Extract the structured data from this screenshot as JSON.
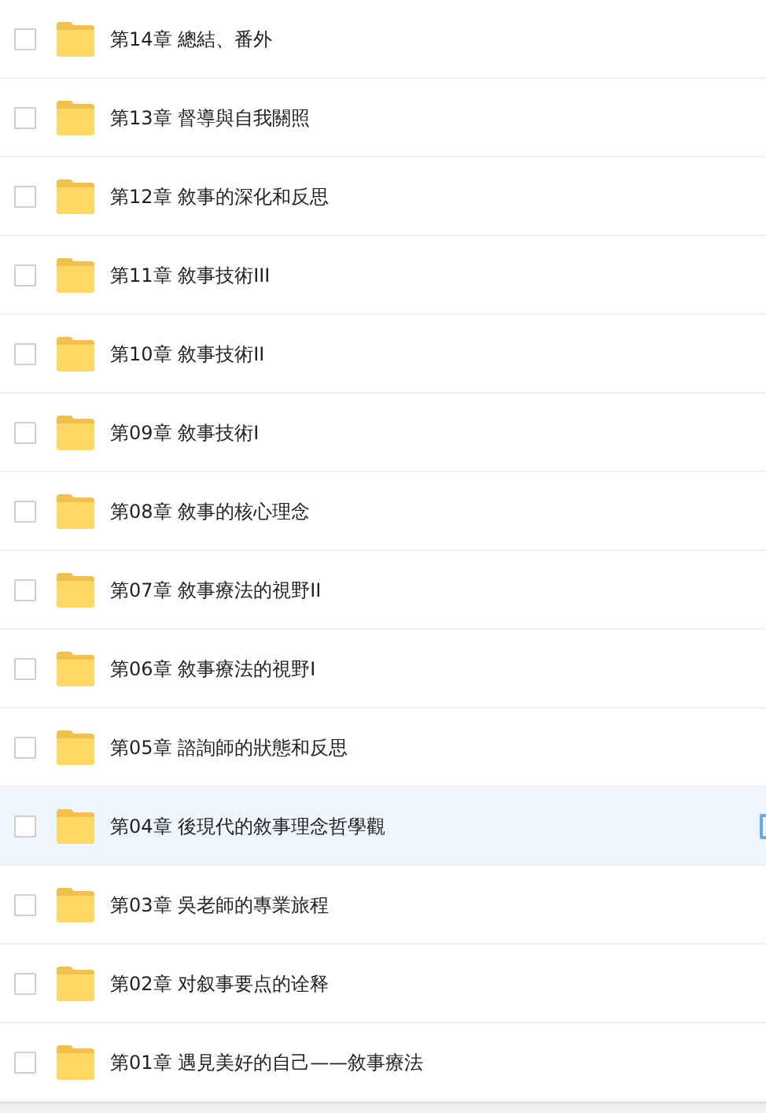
{
  "files": [
    {
      "name": "第14章 總結、番外",
      "checked": false,
      "highlighted": false
    },
    {
      "name": "第13章 督導與自我關照",
      "checked": false,
      "highlighted": false
    },
    {
      "name": "第12章 敘事的深化和反思",
      "checked": false,
      "highlighted": false
    },
    {
      "name": "第11章 敘事技術III",
      "checked": false,
      "highlighted": false
    },
    {
      "name": "第10章 敘事技術II",
      "checked": false,
      "highlighted": false
    },
    {
      "name": "第09章 敘事技術I",
      "checked": false,
      "highlighted": false
    },
    {
      "name": "第08章 敘事的核心理念",
      "checked": false,
      "highlighted": false
    },
    {
      "name": "第07章 敘事療法的視野II",
      "checked": false,
      "highlighted": false
    },
    {
      "name": "第06章 敘事療法的視野I",
      "checked": false,
      "highlighted": false
    },
    {
      "name": "第05章 諮詢師的狀態和反思",
      "checked": false,
      "highlighted": false
    },
    {
      "name": "第04章 後現代的敘事理念哲學觀",
      "checked": false,
      "highlighted": true
    },
    {
      "name": "第03章 吳老師的專業旅程",
      "checked": false,
      "highlighted": false
    },
    {
      "name": "第02章 对叙事要点的诠释",
      "checked": false,
      "highlighted": false
    },
    {
      "name": "第01章 遇見美好的自己——敘事療法",
      "checked": false,
      "highlighted": false
    }
  ]
}
